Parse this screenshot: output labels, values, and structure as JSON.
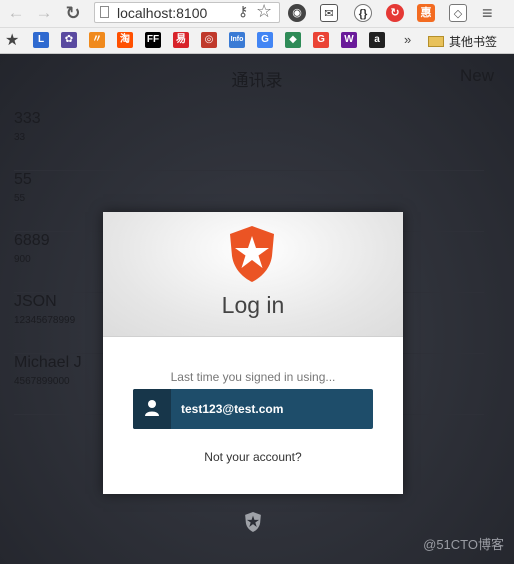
{
  "browser": {
    "url": "localhost:8100",
    "other_bookmarks": "其他书签"
  },
  "bookmarks": [
    {
      "icon": "L",
      "color": "#2f6ad0"
    },
    {
      "icon": "✿",
      "color": "#5a4aa0"
    },
    {
      "icon": "〃",
      "color": "#f08a1c"
    },
    {
      "icon": "淘",
      "color": "#ff5000"
    },
    {
      "icon": "FF",
      "color": "#000000"
    },
    {
      "icon": "易",
      "color": "#d8232a"
    },
    {
      "icon": "◎",
      "color": "#c0392b"
    },
    {
      "icon": "Info",
      "color": "#3a7bd5"
    },
    {
      "icon": "G",
      "color": "#4285f4"
    },
    {
      "icon": "◆",
      "color": "#2e8b57"
    },
    {
      "icon": "G",
      "color": "#ea4335"
    },
    {
      "icon": "W",
      "color": "#6a1b9a"
    },
    {
      "icon": "a",
      "color": "#222222"
    }
  ],
  "app": {
    "title": "通讯录",
    "new_label": "New",
    "contacts": [
      {
        "name": "333",
        "sub": "33"
      },
      {
        "name": "55",
        "sub": "55"
      },
      {
        "name": "6889",
        "sub": "900"
      },
      {
        "name": "JSON",
        "sub": "12345678999"
      },
      {
        "name": "Michael J",
        "sub": "4567899000"
      }
    ]
  },
  "login": {
    "title": "Log in",
    "last_time": "Last time you signed in using...",
    "email": "test123@test.com",
    "not_your_account": "Not your account?",
    "brand_color": "#eb5424",
    "button_color": "#1e4d6a"
  },
  "watermark": "@51CTO博客"
}
